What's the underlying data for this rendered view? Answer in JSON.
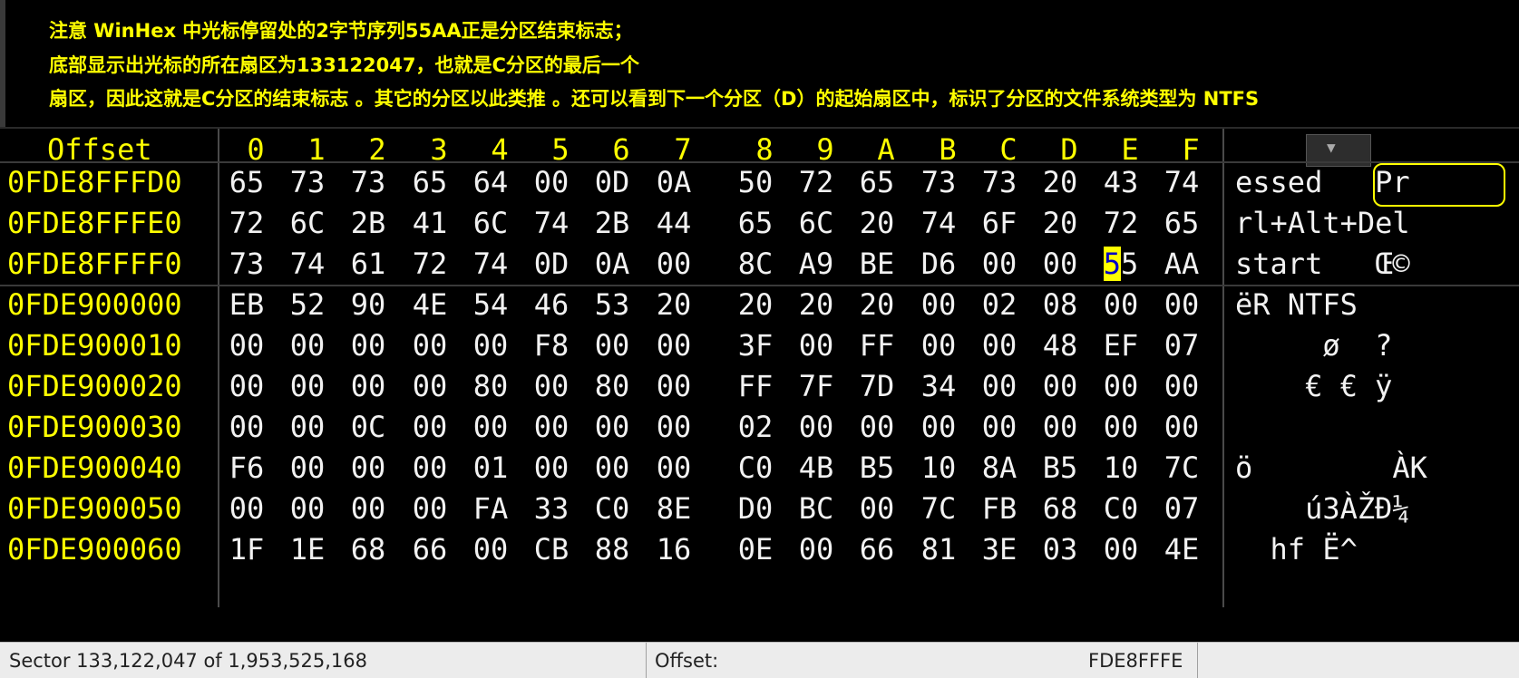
{
  "annotation": {
    "lines": [
      "注意 WinHex 中光标停留处的2字节序列55AA正是分区结束标志；",
      "底部显示出光标的所在扇区为133122047，也就是C分区的最后一个",
      "扇区，因此这就是C分区的结束标志 。其它的分区以此类推  。还可以看到下一个分区（D）的起始扇区中，标识了分区的文件系统类型为 NTFS"
    ]
  },
  "hex": {
    "offset_header": "Offset",
    "column_headers": [
      "0",
      "1",
      "2",
      "3",
      "4",
      "5",
      "6",
      "7",
      "8",
      "9",
      "A",
      "B",
      "C",
      "D",
      "E",
      "F"
    ],
    "rows": [
      {
        "offset": "0FDE8FFFD0",
        "bytes": [
          "65",
          "73",
          "73",
          "65",
          "64",
          "00",
          "0D",
          "0A",
          "50",
          "72",
          "65",
          "73",
          "73",
          "20",
          "43",
          "74"
        ],
        "ascii": "essed   Pr"
      },
      {
        "offset": "0FDE8FFFE0",
        "bytes": [
          "72",
          "6C",
          "2B",
          "41",
          "6C",
          "74",
          "2B",
          "44",
          "65",
          "6C",
          "20",
          "74",
          "6F",
          "20",
          "72",
          "65"
        ],
        "ascii": "rl+Alt+Del"
      },
      {
        "offset": "0FDE8FFFF0",
        "bytes": [
          "73",
          "74",
          "61",
          "72",
          "74",
          "0D",
          "0A",
          "00",
          "8C",
          "A9",
          "BE",
          "D6",
          "00",
          "00",
          "55",
          "AA"
        ],
        "ascii": "start   Œ©"
      },
      {
        "offset": "0FDE900000",
        "bytes": [
          "EB",
          "52",
          "90",
          "4E",
          "54",
          "46",
          "53",
          "20",
          "20",
          "20",
          "20",
          "00",
          "02",
          "08",
          "00",
          "00"
        ],
        "ascii": "ëR NTFS"
      },
      {
        "offset": "0FDE900010",
        "bytes": [
          "00",
          "00",
          "00",
          "00",
          "00",
          "F8",
          "00",
          "00",
          "3F",
          "00",
          "FF",
          "00",
          "00",
          "48",
          "EF",
          "07"
        ],
        "ascii": "     ø  ?"
      },
      {
        "offset": "0FDE900020",
        "bytes": [
          "00",
          "00",
          "00",
          "00",
          "80",
          "00",
          "80",
          "00",
          "FF",
          "7F",
          "7D",
          "34",
          "00",
          "00",
          "00",
          "00"
        ],
        "ascii": "    € € ÿ"
      },
      {
        "offset": "0FDE900030",
        "bytes": [
          "00",
          "00",
          "0C",
          "00",
          "00",
          "00",
          "00",
          "00",
          "02",
          "00",
          "00",
          "00",
          "00",
          "00",
          "00",
          "00"
        ],
        "ascii": ""
      },
      {
        "offset": "0FDE900040",
        "bytes": [
          "F6",
          "00",
          "00",
          "00",
          "01",
          "00",
          "00",
          "00",
          "C0",
          "4B",
          "B5",
          "10",
          "8A",
          "B5",
          "10",
          "7C"
        ],
        "ascii": "ö        ÀK"
      },
      {
        "offset": "0FDE900050",
        "bytes": [
          "00",
          "00",
          "00",
          "00",
          "FA",
          "33",
          "C0",
          "8E",
          "D0",
          "BC",
          "00",
          "7C",
          "FB",
          "68",
          "C0",
          "07"
        ],
        "ascii": "    ú3ÀŽÐ¼"
      },
      {
        "offset": "0FDE900060",
        "bytes": [
          "1F",
          "1E",
          "68",
          "66",
          "00",
          "CB",
          "88",
          "16",
          "0E",
          "00",
          "66",
          "81",
          "3E",
          "03",
          "00",
          "4E"
        ],
        "ascii": "  hf Ë^"
      }
    ],
    "cursor": {
      "row": 2,
      "col": 14
    }
  },
  "status": {
    "sector": "Sector 133,122,047 of 1,953,525,168",
    "offset_label": "Offset:",
    "offset_value": "FDE8FFFE"
  },
  "colors": {
    "offset_text": "#ffff00",
    "byte_text": "#f2f2f2",
    "cursor_bg": "#ffff00",
    "cursor_text": "#0000c8",
    "annotation_text": "#ffff00"
  }
}
